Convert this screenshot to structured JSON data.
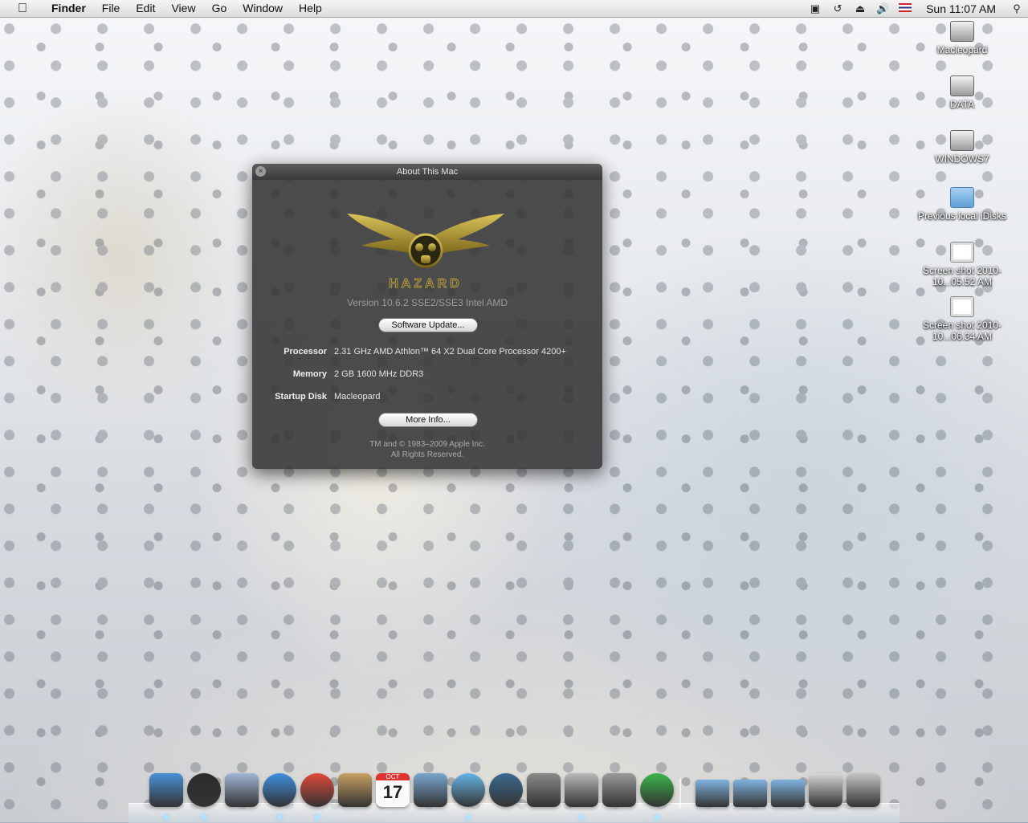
{
  "menubar": {
    "app_name": "Finder",
    "items": [
      "File",
      "Edit",
      "View",
      "Go",
      "Window",
      "Help"
    ],
    "clock": "Sun 11:07 AM",
    "status_icons": [
      "display-icon",
      "time-machine-icon",
      "eject-icon",
      "volume-icon",
      "input-flag-icon",
      "spotlight-icon"
    ]
  },
  "desktop": {
    "icons": [
      {
        "label": "Macleopard",
        "icon": "hard-drive-icon"
      },
      {
        "label": "DATA",
        "icon": "hard-drive-icon"
      },
      {
        "label": "WINDOWS7",
        "icon": "hard-drive-icon"
      },
      {
        "label": "Previous local iDisks",
        "icon": "folder-icon"
      },
      {
        "label": "Screen shot 2010-10...05.52 AM",
        "icon": "image-file-icon"
      },
      {
        "label": "Screen shot 2010-10...06.34 AM",
        "icon": "image-file-icon"
      }
    ]
  },
  "about_window": {
    "title": "About This Mac",
    "version": "Version 10.6.2 SSE2/SSE3 Intel AMD",
    "software_update_label": "Software Update...",
    "processor_label": "Processor",
    "processor_value": "2.31 GHz AMD Athlon™ 64 X2 Dual Core Processor 4200+",
    "memory_label": "Memory",
    "memory_value": "2 GB 1600 MHz DDR3",
    "startup_disk_label": "Startup Disk",
    "startup_disk_value": "Macleopard",
    "more_info_label": "More Info...",
    "copyright_line1": "TM and © 1983–2009 Apple Inc.",
    "copyright_line2": "All Rights Reserved.",
    "logo_text": "HAZARD"
  },
  "dock": {
    "apps": [
      {
        "name": "finder-icon",
        "color": "#4a8fd8"
      },
      {
        "name": "dashboard-icon",
        "color": "#2c2c2c"
      },
      {
        "name": "mail-icon",
        "color": "#9fb6d6"
      },
      {
        "name": "safari-icon",
        "color": "#3e8fe0"
      },
      {
        "name": "chrome-icon",
        "color": "#e04a3a"
      },
      {
        "name": "address-book-icon",
        "color": "#c8a064"
      },
      {
        "name": "ical-icon",
        "color": "#f4f4f4"
      },
      {
        "name": "iphoto-icon",
        "color": "#7aa6cf"
      },
      {
        "name": "itunes-icon",
        "color": "#66b4e8"
      },
      {
        "name": "time-machine-icon",
        "color": "#3a6a8f"
      },
      {
        "name": "system-preferences-icon",
        "color": "#8a8a8a"
      },
      {
        "name": "installer-icon",
        "color": "#b8b8b8"
      },
      {
        "name": "utility-icon",
        "color": "#9a9a9a"
      },
      {
        "name": "utorrent-icon",
        "color": "#3bb54a"
      },
      {
        "name": "applications-folder-icon",
        "color": "#7fb2e0"
      },
      {
        "name": "documents-folder-icon",
        "color": "#7fb2e0"
      },
      {
        "name": "downloads-folder-icon",
        "color": "#7fb2e0"
      },
      {
        "name": "preview-stack-icon",
        "color": "#d8d8d8"
      },
      {
        "name": "trash-icon",
        "color": "#c4c4c4"
      }
    ],
    "ical_day": "17",
    "ical_month": "OCT"
  }
}
